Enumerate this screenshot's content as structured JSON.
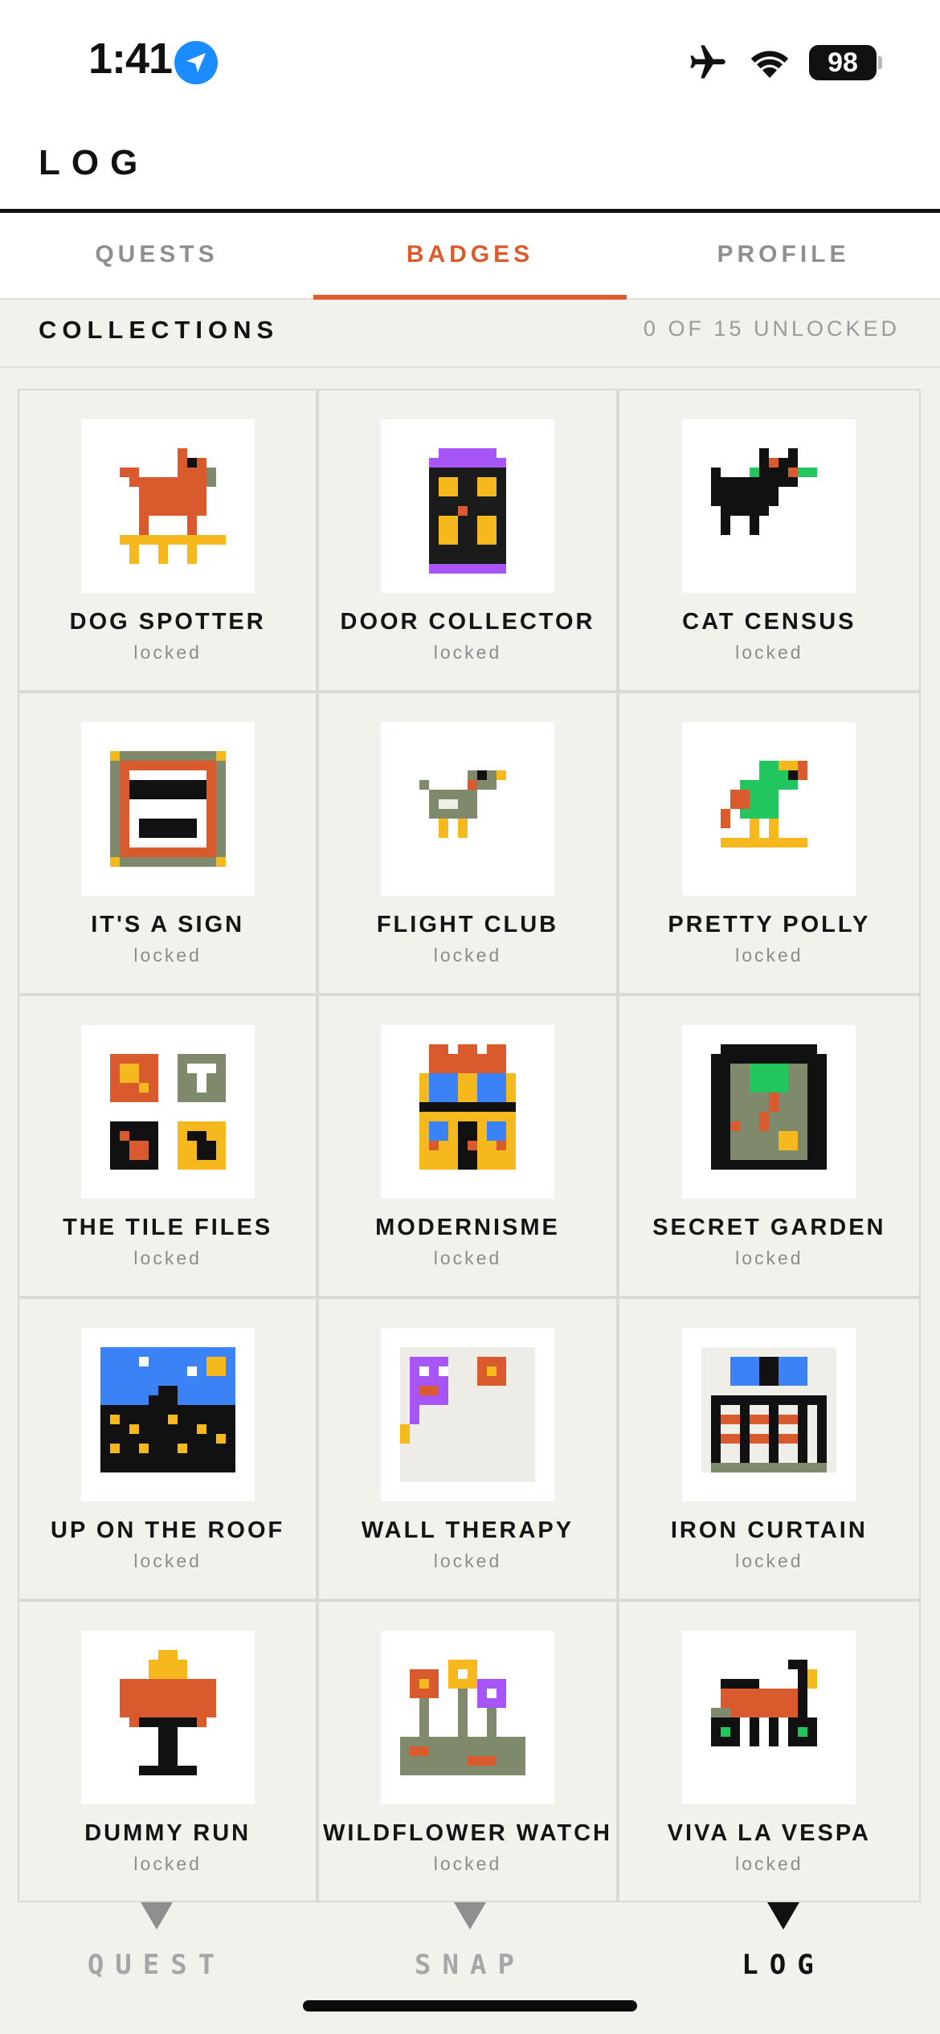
{
  "status_bar": {
    "time": "1:41",
    "battery": "98"
  },
  "header": {
    "title": "LOG"
  },
  "tabs": [
    {
      "label": "QUESTS",
      "active": false
    },
    {
      "label": "BADGES",
      "active": true
    },
    {
      "label": "PROFILE",
      "active": false
    }
  ],
  "collections": {
    "title": "COLLECTIONS",
    "count": "0 OF 15 UNLOCKED"
  },
  "badges": [
    {
      "name": "DOG SPOTTER",
      "status": "locked",
      "icon": "dog-icon"
    },
    {
      "name": "DOOR COLLECTOR",
      "status": "locked",
      "icon": "door-icon"
    },
    {
      "name": "CAT CENSUS",
      "status": "locked",
      "icon": "cat-icon"
    },
    {
      "name": "IT'S A SIGN",
      "status": "locked",
      "icon": "sign-icon"
    },
    {
      "name": "FLIGHT CLUB",
      "status": "locked",
      "icon": "bird-icon"
    },
    {
      "name": "PRETTY POLLY",
      "status": "locked",
      "icon": "parrot-icon"
    },
    {
      "name": "THE TILE FILES",
      "status": "locked",
      "icon": "tiles-icon"
    },
    {
      "name": "MODERNISME",
      "status": "locked",
      "icon": "modernist-building-icon"
    },
    {
      "name": "SECRET GARDEN",
      "status": "locked",
      "icon": "garden-icon"
    },
    {
      "name": "UP ON THE ROOF",
      "status": "locked",
      "icon": "rooftop-skyline-icon"
    },
    {
      "name": "WALL THERAPY",
      "status": "locked",
      "icon": "street-art-icon"
    },
    {
      "name": "IRON CURTAIN",
      "status": "locked",
      "icon": "iron-balcony-icon"
    },
    {
      "name": "DUMMY RUN",
      "status": "locked",
      "icon": "mannequin-icon"
    },
    {
      "name": "WILDFLOWER WATCH",
      "status": "locked",
      "icon": "wildflower-icon"
    },
    {
      "name": "VIVA LA VESPA",
      "status": "locked",
      "icon": "scooter-icon"
    }
  ],
  "bottom_nav": [
    {
      "label": "QUEST",
      "active": false
    },
    {
      "label": "SNAP",
      "active": false
    },
    {
      "label": "LOG",
      "active": true
    }
  ],
  "colors": {
    "accent": "#dc5a2c",
    "background": "#f3f1ec",
    "text": "#141414",
    "muted": "#8c8c8c"
  }
}
